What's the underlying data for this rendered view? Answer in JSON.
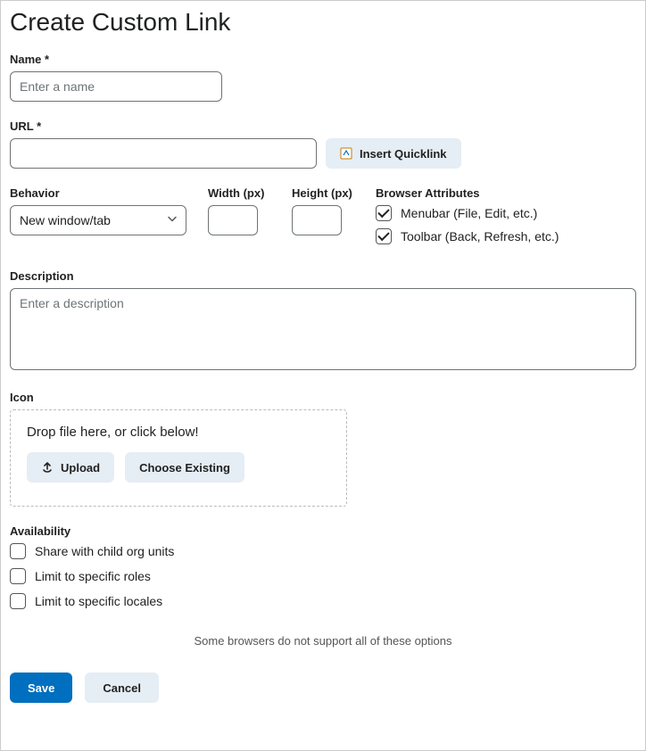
{
  "title": "Create Custom Link",
  "name": {
    "label": "Name *",
    "placeholder": "Enter a name"
  },
  "url": {
    "label": "URL *",
    "insert_quicklink": "Insert Quicklink"
  },
  "behavior": {
    "label": "Behavior",
    "value": "New window/tab"
  },
  "width": {
    "label": "Width (px)"
  },
  "height": {
    "label": "Height (px)"
  },
  "browser": {
    "label": "Browser Attributes",
    "menubar": "Menubar (File, Edit, etc.)",
    "toolbar": "Toolbar (Back, Refresh, etc.)"
  },
  "description": {
    "label": "Description",
    "placeholder": "Enter a description"
  },
  "icon": {
    "label": "Icon",
    "drop_text": "Drop file here, or click below!",
    "upload": "Upload",
    "choose": "Choose Existing"
  },
  "availability": {
    "label": "Availability",
    "share": "Share with child org units",
    "roles": "Limit to specific roles",
    "locales": "Limit to specific locales"
  },
  "note": "Some browsers do not support all of these options",
  "buttons": {
    "save": "Save",
    "cancel": "Cancel"
  }
}
